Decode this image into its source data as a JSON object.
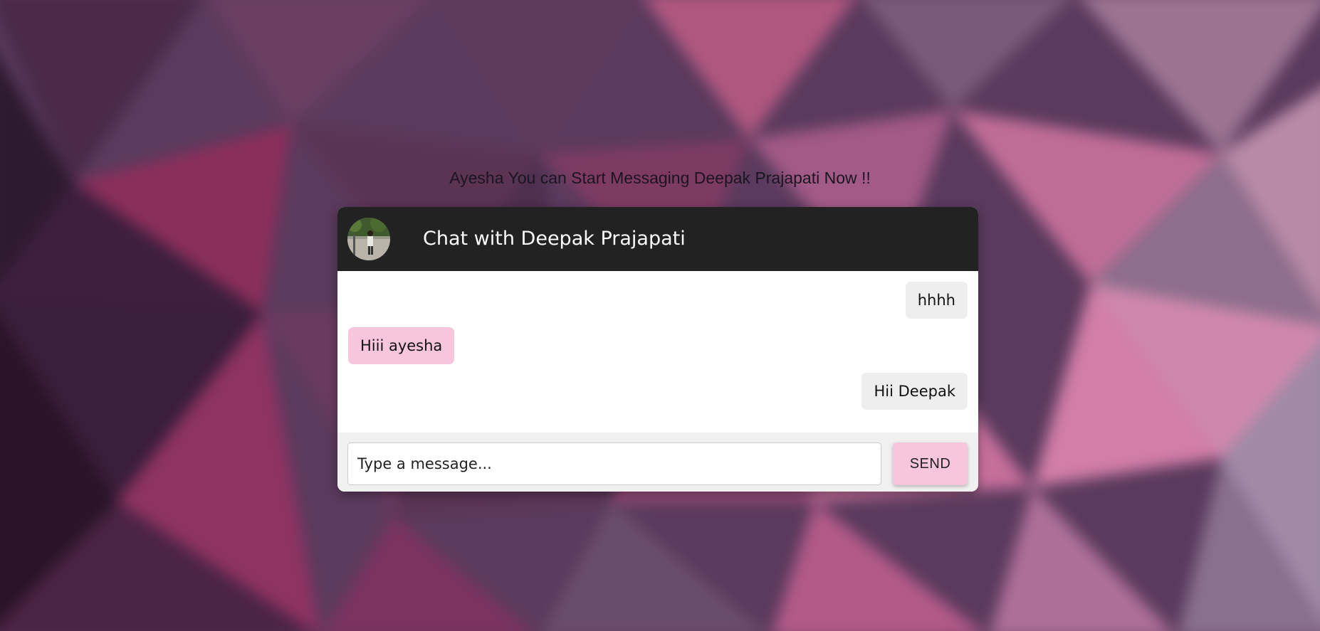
{
  "page": {
    "heading": "Ayesha You can Start Messaging Deepak Prajapati Now !!"
  },
  "chat": {
    "title": "Chat with Deepak Prajapati",
    "messages": [
      {
        "text": "hhhh",
        "direction": "sent"
      },
      {
        "text": "Hiii ayesha",
        "direction": "received"
      },
      {
        "text": "Hii Deepak",
        "direction": "sent"
      }
    ],
    "input": {
      "placeholder": "Type a message...",
      "value": ""
    },
    "send_label": "SEND"
  },
  "colors": {
    "header_bg": "#222222",
    "received_bubble": "#f7c6dc",
    "sent_bubble": "#eeeeee",
    "send_button": "#f7c6dc",
    "composer_bg": "#f0f0f0"
  }
}
